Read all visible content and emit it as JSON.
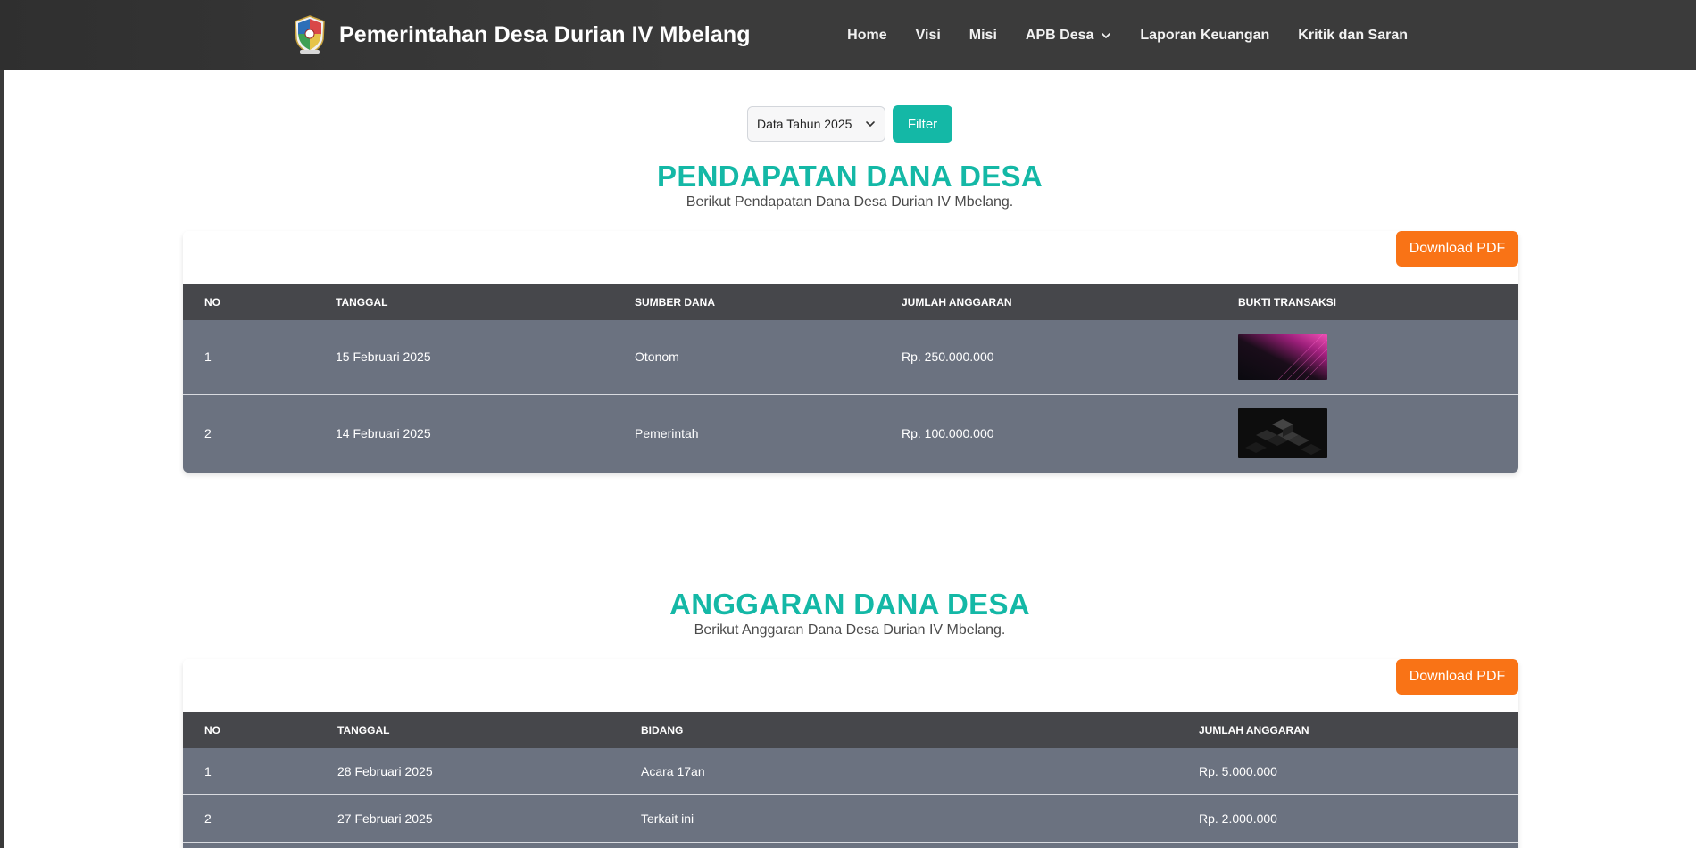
{
  "navbar": {
    "brand_title": "Pemerintahan Desa Durian IV Mbelang",
    "items": [
      {
        "label": "Home"
      },
      {
        "label": "Visi"
      },
      {
        "label": "Misi"
      },
      {
        "label": "APB Desa"
      },
      {
        "label": "Laporan Keuangan"
      },
      {
        "label": "Kritik dan Saran"
      }
    ]
  },
  "filter": {
    "selected_year": "Data Tahun 2025",
    "button_label": "Filter"
  },
  "pendapatan": {
    "title": "PENDAPATAN DANA DESA",
    "subtitle": "Berikut Pendapatan Dana Desa Durian IV Mbelang.",
    "download_label": "Download PDF",
    "columns": [
      "NO",
      "TANGGAL",
      "SUMBER DANA",
      "JUMLAH ANGGARAN",
      "BUKTI TRANSAKSI"
    ],
    "rows": [
      {
        "no": "1",
        "tanggal": "15 Februari 2025",
        "sumber": "Otonom",
        "jumlah": "Rp. 250.000.000",
        "bukti": "pink-abstract-thumbnail"
      },
      {
        "no": "2",
        "tanggal": "14 Februari 2025",
        "sumber": "Pemerintah",
        "jumlah": "Rp. 100.000.000",
        "bukti": "dark-cubes-thumbnail"
      }
    ]
  },
  "anggaran": {
    "title": "ANGGARAN DANA DESA",
    "subtitle": "Berikut Anggaran Dana Desa Durian IV Mbelang.",
    "download_label": "Download PDF",
    "columns": [
      "NO",
      "TANGGAL",
      "BIDANG",
      "JUMLAH ANGGARAN"
    ],
    "rows": [
      {
        "no": "1",
        "tanggal": "28 Februari 2025",
        "bidang": "Acara 17an",
        "jumlah": "Rp. 5.000.000"
      },
      {
        "no": "2",
        "tanggal": "27 Februari 2025",
        "bidang": "Terkait ini",
        "jumlah": "Rp. 2.000.000"
      }
    ]
  },
  "colors": {
    "navbar_bg": "#3b3b3b",
    "accent_teal": "#14b8a6",
    "pdf_orange": "#f97316",
    "table_header": "#46474b",
    "table_row": "#6b7280"
  }
}
